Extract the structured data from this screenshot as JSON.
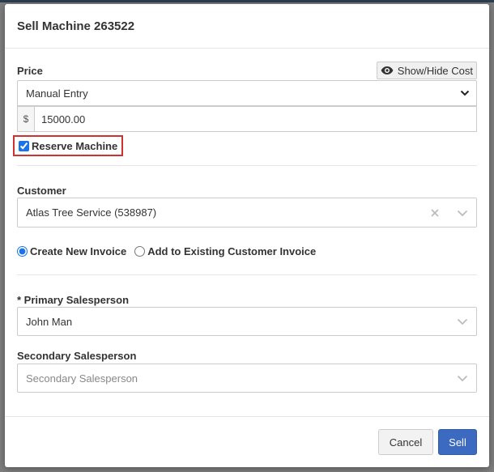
{
  "modal": {
    "title": "Sell Machine 263522"
  },
  "price": {
    "label": "Price",
    "toggle_cost_label": "Show/Hide Cost",
    "mode_selected": "Manual Entry",
    "currency_symbol": "$",
    "amount_value": "15000.00"
  },
  "reserve": {
    "label": "Reserve Machine",
    "checked": true
  },
  "customer": {
    "label": "Customer",
    "selected": "Atlas Tree Service (538987)"
  },
  "invoice_options": {
    "create_new_label": "Create New Invoice",
    "add_existing_label": "Add to Existing Customer Invoice",
    "selected": "create_new"
  },
  "primary_salesperson": {
    "label": "* Primary Salesperson",
    "selected": "John Man"
  },
  "secondary_salesperson": {
    "label": "Secondary Salesperson",
    "placeholder": "Secondary Salesperson"
  },
  "footer": {
    "cancel_label": "Cancel",
    "sell_label": "Sell"
  },
  "colors": {
    "primary": "#3c6ac0",
    "highlight_border": "#d0322f"
  }
}
